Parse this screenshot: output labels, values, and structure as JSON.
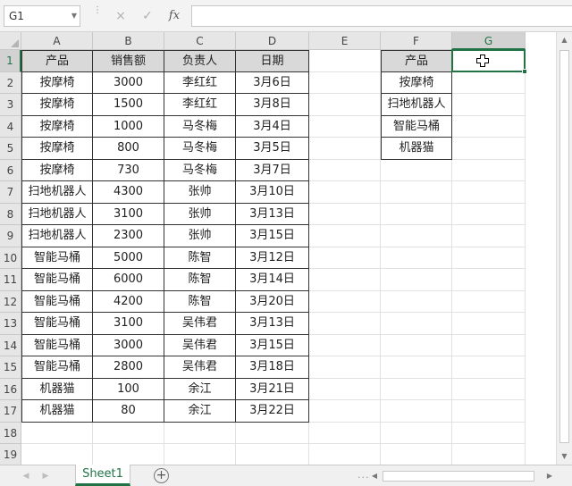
{
  "formula_bar": {
    "name_box": "G1",
    "cancel_icon": "×",
    "enter_icon": "✓",
    "fx_label": "fx",
    "formula": ""
  },
  "columns": [
    "A",
    "B",
    "C",
    "D",
    "E",
    "F",
    "G"
  ],
  "selected_column": "G",
  "row_numbers": [
    "1",
    "2",
    "3",
    "4",
    "5",
    "6",
    "7",
    "8",
    "9",
    "10",
    "11",
    "12",
    "13",
    "14",
    "15",
    "16",
    "17",
    "18",
    "19"
  ],
  "selected_row": "1",
  "table": {
    "headers": [
      "产品",
      "销售额",
      "负责人",
      "日期"
    ],
    "rows": [
      [
        "按摩椅",
        "3000",
        "李红红",
        "3月6日"
      ],
      [
        "按摩椅",
        "1500",
        "李红红",
        "3月8日"
      ],
      [
        "按摩椅",
        "1000",
        "马冬梅",
        "3月4日"
      ],
      [
        "按摩椅",
        "800",
        "马冬梅",
        "3月5日"
      ],
      [
        "按摩椅",
        "730",
        "马冬梅",
        "3月7日"
      ],
      [
        "扫地机器人",
        "4300",
        "张帅",
        "3月10日"
      ],
      [
        "扫地机器人",
        "3100",
        "张帅",
        "3月13日"
      ],
      [
        "扫地机器人",
        "2300",
        "张帅",
        "3月15日"
      ],
      [
        "智能马桶",
        "5000",
        "陈智",
        "3月12日"
      ],
      [
        "智能马桶",
        "6000",
        "陈智",
        "3月14日"
      ],
      [
        "智能马桶",
        "4200",
        "陈智",
        "3月20日"
      ],
      [
        "智能马桶",
        "3100",
        "吴伟君",
        "3月13日"
      ],
      [
        "智能马桶",
        "3000",
        "吴伟君",
        "3月15日"
      ],
      [
        "智能马桶",
        "2800",
        "吴伟君",
        "3月18日"
      ],
      [
        "机器猫",
        "100",
        "余江",
        "3月21日"
      ],
      [
        "机器猫",
        "80",
        "余江",
        "3月22日"
      ]
    ]
  },
  "product_list": {
    "header": "产品",
    "items": [
      "按摩椅",
      "扫地机器人",
      "智能马桶",
      "机器猫"
    ]
  },
  "sheet_tabs": [
    {
      "label": "Sheet1",
      "active": true
    }
  ],
  "sheet_nav": {
    "prev": "◀",
    "next": "▶",
    "add": "+",
    "dots": "..."
  },
  "colors": {
    "accent": "#217346",
    "header_fill": "#d9d9d9"
  }
}
